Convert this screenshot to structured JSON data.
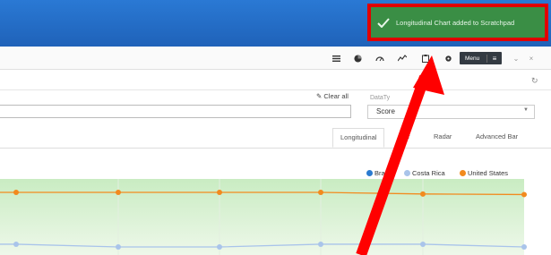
{
  "toast": {
    "message": "Longitudinal Chart added to Scratchpad"
  },
  "toolbar": {
    "icons": [
      "list-icon",
      "pie-chart-icon",
      "gauge-icon",
      "line-chart-icon",
      "clipboard-icon",
      "gear-icon"
    ],
    "menu_label": "Menu",
    "minimize_label": "⌄",
    "close_label": "×"
  },
  "filters": {
    "clear_all_label": "Clear all",
    "datatype_label": "DataTy",
    "datatype_value": "Score",
    "refresh_label": "↻"
  },
  "tabs": [
    {
      "label": "Longitudinal",
      "active": true
    },
    {
      "label": "ar",
      "active": false
    },
    {
      "label": "Radar",
      "active": false
    },
    {
      "label": "Advanced Bar",
      "active": false
    }
  ],
  "colors": {
    "brazil": "#2b7bd0",
    "costa_rica": "#a9c4ea",
    "united_states": "#f28a1e",
    "plot_bg": "#d9f2d4",
    "annotation": "#ff0000"
  },
  "chart_data": {
    "type": "line",
    "series": [
      {
        "name": "Bra",
        "values": []
      },
      {
        "name": "Costa Rica",
        "values": [
          0.05,
          0.05,
          0.0,
          0.0,
          0.05,
          0.05,
          0.0
        ]
      },
      {
        "name": "United States",
        "values": [
          1.0,
          1.0,
          1.0,
          1.0,
          1.0,
          0.97,
          0.96
        ]
      }
    ],
    "grid": true,
    "legend": "top-right"
  }
}
